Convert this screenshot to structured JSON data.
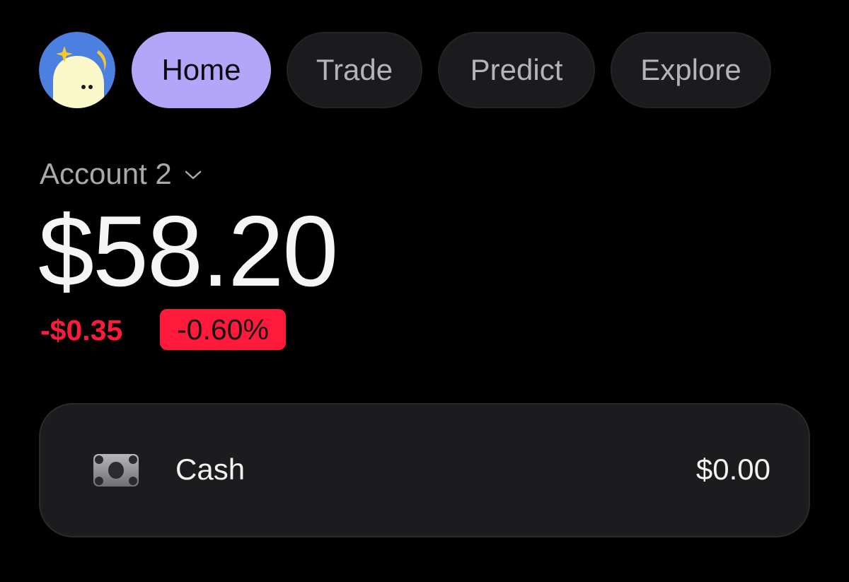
{
  "nav": {
    "avatar_icon": "ghost-avatar-icon",
    "tabs": [
      {
        "label": "Home",
        "active": true
      },
      {
        "label": "Trade",
        "active": false
      },
      {
        "label": "Predict",
        "active": false
      },
      {
        "label": "Explore",
        "active": false
      }
    ]
  },
  "account": {
    "name": "Account 2",
    "dropdown_icon": "chevron-down-icon",
    "balance": "$58.20",
    "change_amount": "-$0.35",
    "change_percent": "-0.60%"
  },
  "holdings": {
    "cash": {
      "icon": "banknote-icon",
      "label": "Cash",
      "value": "$0.00"
    }
  },
  "colors": {
    "background": "#000000",
    "accent": "#b3a6f9",
    "negative": "#ff1a3c",
    "card": "#1c1c1e",
    "pill": "#1b1b1d"
  }
}
